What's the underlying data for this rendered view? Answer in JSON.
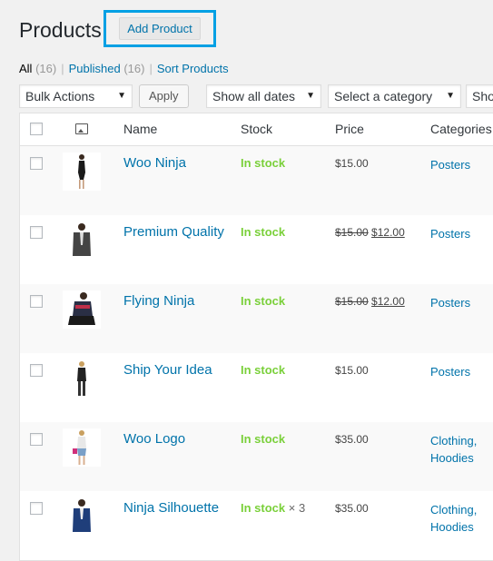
{
  "header": {
    "title": "Products",
    "add_button_label": "Add Product"
  },
  "views": [
    {
      "label": "All",
      "count": "(16)"
    },
    {
      "label": "Published",
      "count": "(16)"
    },
    {
      "label": "Sort Products"
    }
  ],
  "tablenav": {
    "bulk_actions": "Bulk Actions",
    "apply_label": "Apply",
    "dates_filter": "Show all dates",
    "category_filter": "Select a category",
    "type_filter_partial": "Sho"
  },
  "columns": {
    "name": "Name",
    "stock": "Stock",
    "price": "Price",
    "categories": "Categories",
    "image_icon": "image-icon"
  },
  "products": [
    {
      "name": "Woo Ninja",
      "stock": "In stock",
      "qty": "",
      "regular_price": "$15.00",
      "sale_price": "",
      "categories": [
        "Posters"
      ]
    },
    {
      "name": "Premium Quality",
      "stock": "In stock",
      "qty": "",
      "regular_price": "$15.00",
      "sale_price": "$12.00",
      "categories": [
        "Posters"
      ]
    },
    {
      "name": "Flying Ninja",
      "stock": "In stock",
      "qty": "",
      "regular_price": "$15.00",
      "sale_price": "$12.00",
      "categories": [
        "Posters"
      ]
    },
    {
      "name": "Ship Your Idea",
      "stock": "In stock",
      "qty": "",
      "regular_price": "$15.00",
      "sale_price": "",
      "categories": [
        "Posters"
      ]
    },
    {
      "name": "Woo Logo",
      "stock": "In stock",
      "qty": "",
      "regular_price": "$35.00",
      "sale_price": "",
      "categories": [
        "Clothing,",
        "Hoodies"
      ]
    },
    {
      "name": "Ninja Silhouette",
      "stock": "In stock",
      "qty": "× 3",
      "regular_price": "$35.00",
      "sale_price": "",
      "categories": [
        "Clothing,",
        "Hoodies"
      ]
    }
  ],
  "colors": {
    "highlight_border": "#00a0e4",
    "link": "#0073aa",
    "in_stock": "#7ad03a"
  }
}
